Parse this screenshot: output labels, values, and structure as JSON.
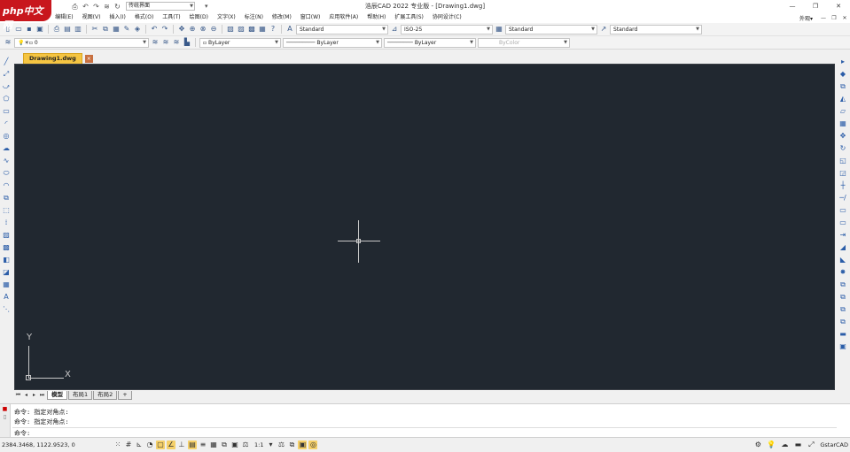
{
  "app": {
    "title": "浩辰CAD 2022 专业版 - [Drawing1.dwg]",
    "workspace": "传统界面",
    "logo": "php中文网"
  },
  "window_controls": {
    "minimize": "—",
    "restore": "❐",
    "close": "✕"
  },
  "menu": {
    "items": [
      "文件(F)",
      "编辑(E)",
      "视图(V)",
      "插入(I)",
      "格式(O)",
      "工具(T)",
      "绘图(D)",
      "文字(X)",
      "标注(N)",
      "修改(M)",
      "窗口(W)",
      "应用软件(A)",
      "帮助(H)",
      "扩展工具(S)",
      "协同设计(C)"
    ],
    "skin": "外观▾"
  },
  "toolbar": {
    "text_style": "Standard",
    "dim_style": "ISO-25",
    "table_style": "Standard",
    "multileader_style": "Standard",
    "layer": "0",
    "color": "ByLayer",
    "linetype": "ByLayer",
    "lineweight": "ByLayer",
    "plotstyle": "ByColor"
  },
  "doc_tab": {
    "name": "Drawing1.dwg",
    "close": "×"
  },
  "layout_tabs": [
    "模型",
    "布局1",
    "布局2",
    "+"
  ],
  "canvas": {
    "bg": "#212830",
    "ucs_x": "X",
    "ucs_y": "Y"
  },
  "command": {
    "lines": [
      "命令: 指定对角点:",
      "命令: 指定对角点:"
    ],
    "prompt": "命令:"
  },
  "status": {
    "coords": "2384.3468, 1122.9523, 0",
    "scale": "1:1",
    "brand": "GstarCAD"
  }
}
